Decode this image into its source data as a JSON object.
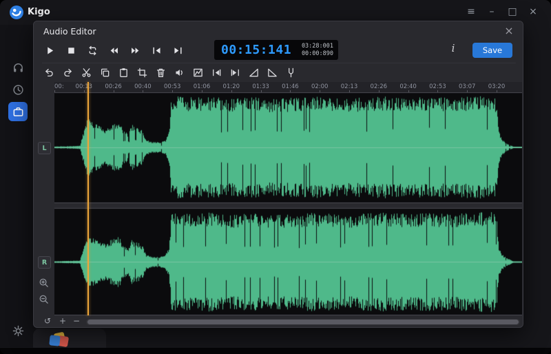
{
  "window": {
    "app_title": "Kigo",
    "controls": [
      {
        "name": "menu",
        "glyph": "≡"
      },
      {
        "name": "minimize",
        "glyph": "–"
      },
      {
        "name": "maximize",
        "glyph": "□"
      },
      {
        "name": "close",
        "glyph": "×"
      }
    ]
  },
  "sidebar": {
    "items": [
      {
        "name": "headphones",
        "active": false
      },
      {
        "name": "history",
        "active": false
      },
      {
        "name": "store",
        "active": true
      },
      {
        "name": "settings",
        "active": false
      }
    ]
  },
  "dialog": {
    "title": "Audio Editor",
    "close_glyph": "×",
    "transport": {
      "buttons": [
        {
          "name": "play"
        },
        {
          "name": "stop"
        },
        {
          "name": "loop"
        },
        {
          "name": "rewind"
        },
        {
          "name": "fast-forward"
        },
        {
          "name": "skip-start"
        },
        {
          "name": "skip-end"
        }
      ]
    },
    "time_display": {
      "current": "00:15:141",
      "total": "03:28:001",
      "selection": "00:00:890"
    },
    "info_label": "i",
    "save_label": "Save",
    "edit_toolbar": {
      "buttons": [
        {
          "name": "undo"
        },
        {
          "name": "redo"
        },
        {
          "name": "cut"
        },
        {
          "name": "copy"
        },
        {
          "name": "paste"
        },
        {
          "name": "crop"
        },
        {
          "name": "delete"
        },
        {
          "name": "volume"
        },
        {
          "name": "envelope"
        },
        {
          "name": "trim-start"
        },
        {
          "name": "trim-end"
        },
        {
          "name": "fade-in"
        },
        {
          "name": "fade-out"
        },
        {
          "name": "pitch"
        }
      ]
    },
    "ruler_ticks": [
      "00:",
      "00:13",
      "00:26",
      "00:40",
      "00:53",
      "01:06",
      "01:20",
      "01:33",
      "01:46",
      "02:00",
      "02:13",
      "02:26",
      "02:40",
      "02:53",
      "03:07",
      "03:20"
    ],
    "channels": [
      {
        "label": "L"
      },
      {
        "label": "R"
      }
    ],
    "bottom_bar": {
      "reset_glyph": "↺",
      "zoom_in_glyph": "+",
      "zoom_out_glyph": "−"
    },
    "playhead": {
      "time_seconds": 15.141,
      "color": "#eda63a"
    },
    "waveform": {
      "color": "#4fb98a",
      "background": "#0b0b0d",
      "envelope": [
        [
          0,
          0.015
        ],
        [
          11.5,
          0.03
        ],
        [
          13,
          0.28
        ],
        [
          15,
          0.55
        ],
        [
          17,
          0.5
        ],
        [
          20,
          0.42
        ],
        [
          23,
          0.36
        ],
        [
          26,
          0.44
        ],
        [
          29,
          0.5
        ],
        [
          31,
          0.34
        ],
        [
          33,
          0.26
        ],
        [
          35,
          0.42
        ],
        [
          38,
          0.38
        ],
        [
          40,
          0.3
        ],
        [
          41.5,
          0.14
        ],
        [
          44,
          0.11
        ],
        [
          47,
          0.1
        ],
        [
          50,
          0.12
        ],
        [
          52,
          0.3
        ],
        [
          53,
          0.96
        ],
        [
          60,
          0.93
        ],
        [
          70,
          0.95
        ],
        [
          80,
          0.9
        ],
        [
          90,
          0.94
        ],
        [
          100,
          0.9
        ],
        [
          110,
          0.93
        ],
        [
          120,
          0.95
        ],
        [
          130,
          0.9
        ],
        [
          140,
          0.93
        ],
        [
          150,
          0.95
        ],
        [
          160,
          0.92
        ],
        [
          170,
          0.94
        ],
        [
          180,
          0.92
        ],
        [
          190,
          0.95
        ],
        [
          199,
          0.96
        ],
        [
          200.5,
          0.85
        ],
        [
          201.5,
          0.3
        ],
        [
          203,
          0.15
        ],
        [
          205,
          0.08
        ],
        [
          207,
          0.04
        ],
        [
          208,
          0.015
        ],
        [
          212,
          0.01
        ]
      ]
    }
  }
}
